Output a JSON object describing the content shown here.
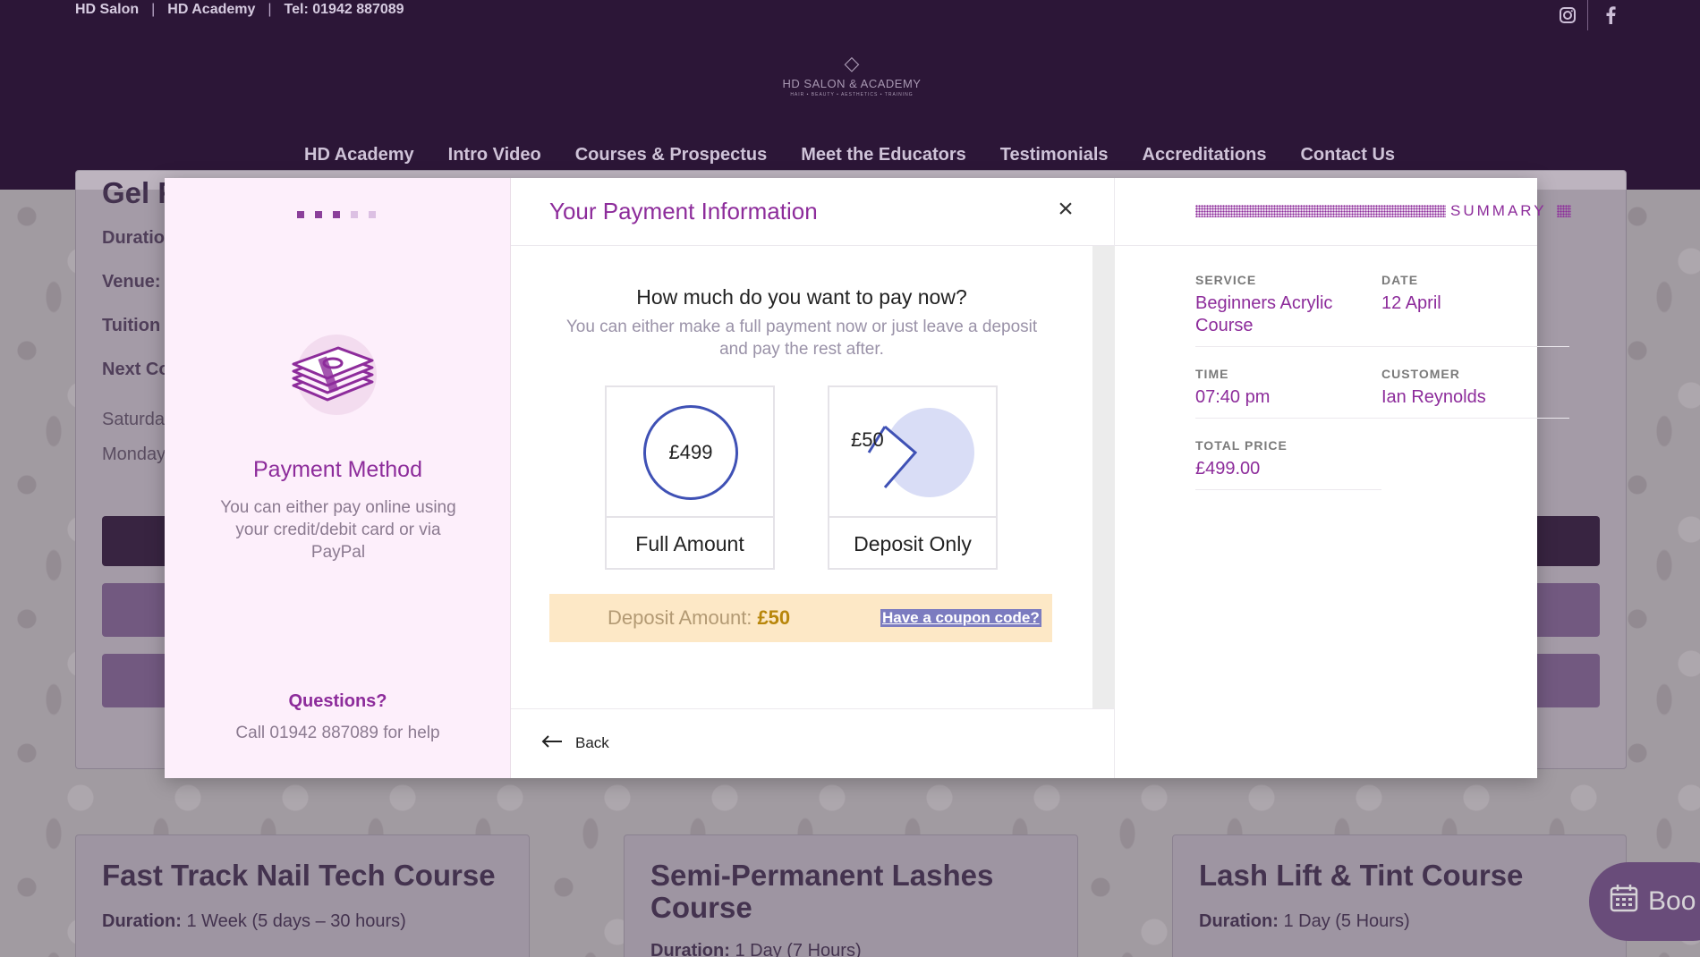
{
  "topbar": {
    "links": [
      "HD Salon",
      "HD Academy",
      "Tel: 01942 887089"
    ],
    "social_icons": [
      "instagram-icon",
      "facebook-icon"
    ]
  },
  "logo": {
    "name": "HD SALON & ACADEMY",
    "tagline": "HAIR • BEAUTY • AESTHETICS • TRAINING"
  },
  "nav": {
    "items": [
      "HD Academy",
      "Intro Video",
      "Courses & Prospectus",
      "Meet the Educators",
      "Testimonials",
      "Accreditations",
      "Contact Us"
    ]
  },
  "background": {
    "main_card": {
      "title_partial": "Gel F",
      "lines": [
        "Duratio",
        "Venue:",
        "Tuition",
        "Next Co"
      ],
      "days": [
        "Saturda",
        "Monday"
      ]
    },
    "cards": [
      {
        "title": "Fast Track Nail Tech Course",
        "duration_label": "Duration:",
        "duration": "1 Week (5 days – 30 hours)"
      },
      {
        "title": "Semi-Permanent Lashes Course",
        "duration_label": "Duration:",
        "duration": "1 Day (7 Hours)"
      },
      {
        "title": "Lash Lift & Tint Course",
        "duration_label": "Duration:",
        "duration": "1 Day (5 Hours)"
      }
    ],
    "book_button": "Boo"
  },
  "modal": {
    "steps": {
      "total": 5,
      "completed": 3
    },
    "left": {
      "title": "Payment Method",
      "description": "You can either pay online using your credit/debit card or via PayPal",
      "questions_title": "Questions?",
      "questions_text": "Call 01942 887089 for help"
    },
    "middle": {
      "title": "Your Payment Information",
      "question": "How much do you want to pay now?",
      "description": "You can either make a full payment now or just leave a deposit and pay the rest after.",
      "options": [
        {
          "amount": "£499",
          "label": "Full Amount"
        },
        {
          "amount": "£50",
          "label": "Deposit Only"
        }
      ],
      "deposit_label": "Deposit Amount:",
      "deposit_value": "£50",
      "coupon_link": "Have a coupon code?",
      "back_label": "Back"
    },
    "summary": {
      "title": "SUMMARY",
      "service_label": "SERVICE",
      "service_value": "Beginners Acrylic Course",
      "date_label": "DATE",
      "date_value": "12 April",
      "time_label": "TIME",
      "time_value": "07:40 pm",
      "customer_label": "CUSTOMER",
      "customer_value": "Ian Reynolds",
      "price_label": "TOTAL PRICE",
      "price_value": "£499.00"
    }
  },
  "colors": {
    "header_bg": "#2c1637",
    "accent_purple": "#8d2c9b",
    "left_pane_bg": "#fdeffb",
    "deposit_bar_bg": "#fde8c6",
    "option_circle": "#3f51b5"
  }
}
